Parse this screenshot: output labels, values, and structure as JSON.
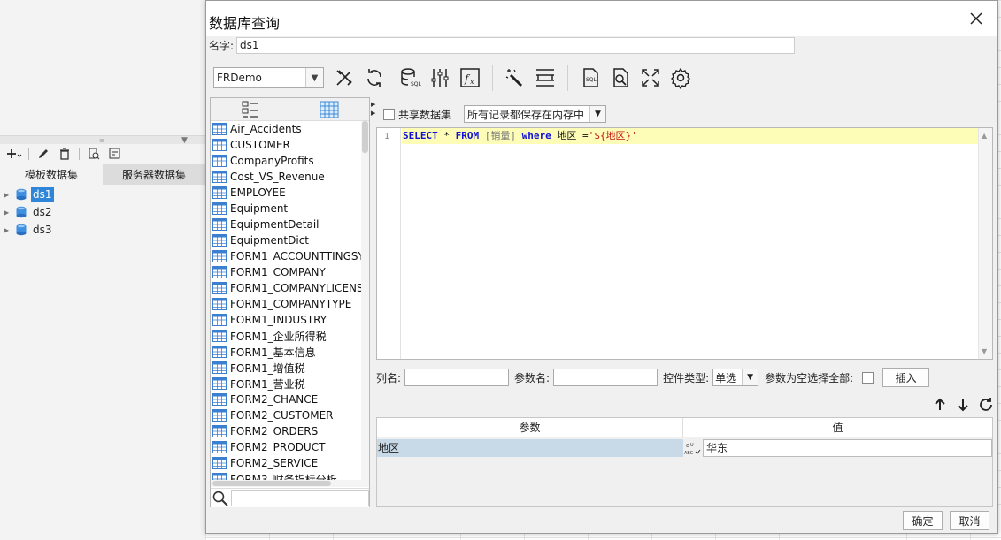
{
  "workspace": {
    "tabs": [
      {
        "label": "模板数据集",
        "active": true
      },
      {
        "label": "服务器数据集",
        "active": false
      }
    ],
    "datasets": [
      {
        "label": "ds1",
        "selected": true
      },
      {
        "label": "ds2",
        "selected": false
      },
      {
        "label": "ds3",
        "selected": false
      }
    ]
  },
  "dialog": {
    "title": "数据库查询",
    "name_label": "名字:",
    "name_value": "ds1",
    "connection": "FRDemo",
    "toolbar_icons": [
      "edit-connection-icon",
      "refresh-icon",
      "sql-database-icon",
      "filter-settings-icon",
      "formula-icon",
      "magic-wand-icon",
      "column-width-icon",
      "sql-file-icon",
      "preview-icon",
      "expand-icon",
      "settings-icon"
    ],
    "tables": [
      "Air_Accidents",
      "CUSTOMER",
      "CompanyProfits",
      "Cost_VS_Revenue",
      "EMPLOYEE",
      "Equipment",
      "EquipmentDetail",
      "EquipmentDict",
      "FORM1_ACCOUNTTINGSY",
      "FORM1_COMPANY",
      "FORM1_COMPANYLICENS",
      "FORM1_COMPANYTYPE",
      "FORM1_INDUSTRY",
      "FORM1_企业所得税",
      "FORM1_基本信息",
      "FORM1_增值税",
      "FORM1_营业税",
      "FORM2_CHANCE",
      "FORM2_CUSTOMER",
      "FORM2_ORDERS",
      "FORM2_PRODUCT",
      "FORM2_SERVICE",
      "FORM3_财务指标分析"
    ],
    "share_dataset_label": "共享数据集",
    "memory_option": "所有记录都保存在内存中",
    "sql": {
      "line_number": "1",
      "tokens": [
        {
          "t": "SELECT",
          "c": "kw"
        },
        {
          "t": " * ",
          "c": "txt"
        },
        {
          "t": "FROM",
          "c": "kw"
        },
        {
          "t": " ",
          "c": "txt"
        },
        {
          "t": "[销量]",
          "c": "tok-ident"
        },
        {
          "t": " ",
          "c": "txt"
        },
        {
          "t": "where",
          "c": "kw"
        },
        {
          "t": " 地区 =",
          "c": "txt"
        },
        {
          "t": "'${地区}'",
          "c": "tok-str"
        }
      ]
    },
    "column_name_label": "列名:",
    "param_name_label": "参数名:",
    "control_type_label": "控件类型:",
    "control_type_value": "单选",
    "select_all_label": "参数为空选择全部:",
    "insert_label": "插入",
    "param_table": {
      "headers": [
        "参数",
        "值"
      ],
      "rows": [
        {
          "param": "地区",
          "value": "华东"
        }
      ]
    },
    "ok_label": "确定",
    "cancel_label": "取消",
    "colors": {
      "accent": "#2f86d8",
      "sql_line": "#fdfdb8",
      "selected_row": "#c8dae8"
    }
  }
}
